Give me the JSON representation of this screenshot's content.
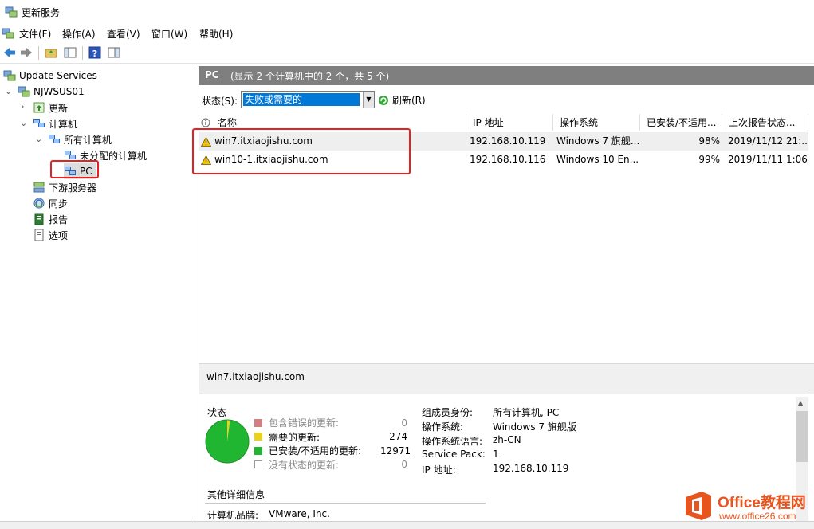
{
  "window": {
    "title": "更新服务"
  },
  "menu": [
    "文件(F)",
    "操作(A)",
    "查看(V)",
    "窗口(W)",
    "帮助(H)"
  ],
  "tree": {
    "root": "Update Services",
    "server": "NJWSUS01",
    "updates": "更新",
    "computers": "计算机",
    "all_computers": "所有计算机",
    "unassigned": "未分配的计算机",
    "pc": "PC",
    "downstream": "下游服务器",
    "sync": "同步",
    "reports": "报告",
    "options": "选项"
  },
  "pane": {
    "title": "PC",
    "subtitle": "(显示 2 个计算机中的 2 个，共 5 个)"
  },
  "filter": {
    "label": "状态(S):",
    "value": "失败或需要的",
    "refresh": "刷新(R)"
  },
  "grid": {
    "columns": [
      "名称",
      "IP 地址",
      "操作系统",
      "已安装/不适用...",
      "上次报告状态..."
    ],
    "rows": [
      {
        "name": "win7.itxiaojishu.com",
        "ip": "192.168.10.119",
        "os": "Windows 7 旗舰...",
        "pct": "98%",
        "last": "2019/11/12 21:..."
      },
      {
        "name": "win10-1.itxiaojishu.com",
        "ip": "192.168.10.116",
        "os": "Windows 10 En...",
        "pct": "99%",
        "last": "2019/11/11 1:06"
      }
    ]
  },
  "detail": {
    "title": "win7.itxiaojishu.com",
    "status_heading": "状态",
    "legend": [
      {
        "label": "包含错误的更新:",
        "value": "0",
        "color": "#d08080",
        "muted": true
      },
      {
        "label": "需要的更新:",
        "value": "274",
        "color": "#e8d21c",
        "muted": false
      },
      {
        "label": "已安装/不适用的更新:",
        "value": "12971",
        "color": "#21b631",
        "muted": false
      },
      {
        "label": "没有状态的更新:",
        "value": "0",
        "color": "#ffffff",
        "muted": true
      }
    ],
    "chart_data": {
      "type": "pie",
      "categories": [
        "包含错误的更新",
        "需要的更新",
        "已安装/不适用的更新",
        "没有状态的更新"
      ],
      "values": [
        0,
        274,
        12971,
        0
      ],
      "colors": [
        "#d08080",
        "#e8d21c",
        "#21b631",
        "#ffffff"
      ]
    },
    "props": [
      {
        "k": "组成员身份:",
        "v": "所有计算机, PC"
      },
      {
        "k": "操作系统:",
        "v": "Windows 7 旗舰版"
      },
      {
        "k": "操作系统语言:",
        "v": "zh-CN"
      },
      {
        "k": "Service Pack:",
        "v": "1"
      },
      {
        "k": "IP 地址:",
        "v": "192.168.10.119"
      }
    ],
    "other_heading": "其他详细信息",
    "brand_label": "计算机品牌:",
    "brand_value": "VMware, Inc."
  },
  "watermark": {
    "brand": "Office教程网",
    "url": "www.office26.com"
  }
}
